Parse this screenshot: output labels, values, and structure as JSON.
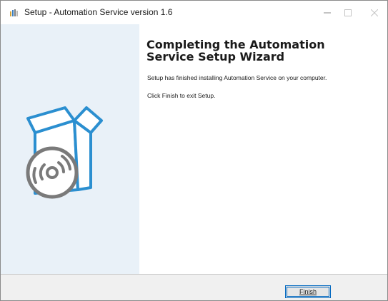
{
  "window": {
    "title": "Setup - Automation Service version 1.6",
    "minimize_icon": "minimize-icon",
    "maximize_icon": "maximize-icon",
    "close_icon": "close-icon"
  },
  "sidebar": {
    "image_icon": "software-box-cd-icon"
  },
  "content": {
    "heading": "Completing the Automation Service Setup Wizard",
    "paragraph1": "Setup has finished installing Automation Service on your computer.",
    "paragraph2": "Click Finish to exit Setup."
  },
  "footer": {
    "finish_label": "Finish"
  },
  "colors": {
    "sidebar_bg": "#e9f1f8",
    "icon_blue": "#2b8fd0",
    "disc_gray": "#7a7a7a",
    "button_border": "#0067c0"
  }
}
